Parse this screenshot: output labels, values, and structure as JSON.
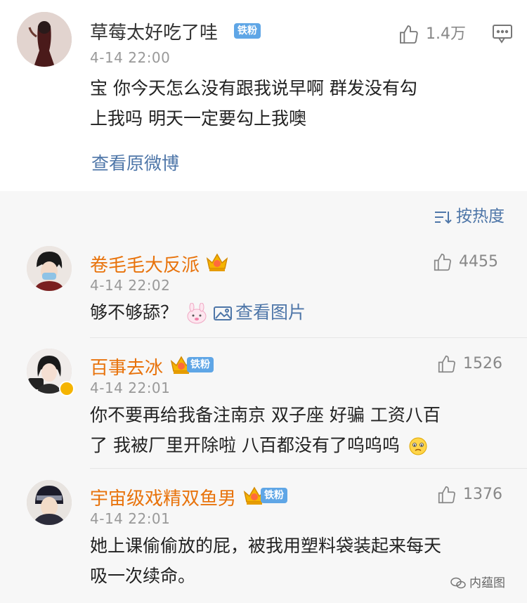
{
  "post": {
    "username": "草莓太好吃了哇",
    "badge": "铁粉",
    "time": "4-14 22:00",
    "likes": "1.4万",
    "content_line1": "宝 你今天怎么没有跟我说早啊 群发没有勾",
    "content_line2": "上我吗 明天一定要勾上我噢",
    "view_original": "查看原微博"
  },
  "sort": {
    "label": "按热度"
  },
  "comments": [
    {
      "username": "卷毛毛大反派",
      "time": "4-14 22:02",
      "likes": "4455",
      "content_line1": "够不够舔？",
      "view_image": "查看图片"
    },
    {
      "username": "百事去冰",
      "badge": "铁粉",
      "time": "4-14 22:01",
      "likes": "1526",
      "content_line1": "你不要再给我备注南京 双子座 好骗 工资八百",
      "content_line2": "了 我被厂里开除啦 八百都没有了呜呜呜"
    },
    {
      "username": "宇宙级戏精双鱼男",
      "badge": "铁粉",
      "time": "4-14 22:01",
      "likes": "1376",
      "content_line1": "她上课偷偷放的屁，被我用塑料袋装起来每天",
      "content_line2": "吸一次续命。"
    }
  ],
  "watermark": {
    "text": "内蕴图"
  },
  "colors": {
    "username_orange": "#e8730c",
    "username_dark": "#333333",
    "link_blue": "#4e76a8",
    "badge_blue": "#5fa6e6",
    "time_gray": "#999999"
  },
  "icons": [
    "thumbs-up-icon",
    "comment-icon",
    "sort-icon",
    "image-icon",
    "crown-icon",
    "emoji-icon"
  ]
}
